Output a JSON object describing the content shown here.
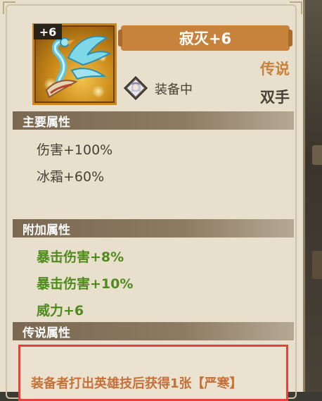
{
  "item": {
    "level_badge": "+6",
    "name": "寂灭+6",
    "rarity": "传说",
    "hand_type": "双手",
    "equipped_label": "装备中",
    "icon": "swan-weapon-icon"
  },
  "sections": {
    "main_title": "主要属性",
    "extra_title": "附加属性",
    "legend_title": "传说属性"
  },
  "main_attributes": [
    "伤害+100%",
    "冰霜+60%"
  ],
  "extra_attributes": [
    "暴击伤害+8%",
    "暴击伤害+10%",
    "威力+6"
  ],
  "legend_text": "装备者打出英雄技后获得1张【严寒】",
  "colors": {
    "rarity": "#c7823b",
    "extra_attr": "#4f8a1c",
    "legend_text": "#c4713a",
    "highlight_border": "#e8413a"
  }
}
